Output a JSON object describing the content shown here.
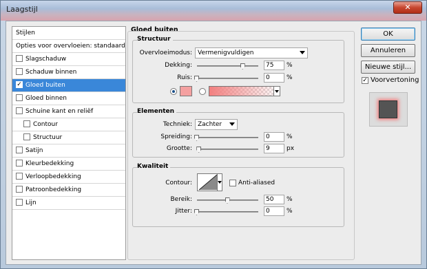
{
  "window": {
    "title": "Laagstijl",
    "close_glyph": "✕"
  },
  "style_list": {
    "header": "Stijlen",
    "blending": "Opties voor overvloeien: standaard",
    "items": [
      {
        "label": "Slagschaduw",
        "checked": false,
        "selected": false,
        "indent": false
      },
      {
        "label": "Schaduw binnen",
        "checked": false,
        "selected": false,
        "indent": false
      },
      {
        "label": "Gloed buiten",
        "checked": true,
        "selected": true,
        "indent": false
      },
      {
        "label": "Gloed binnen",
        "checked": false,
        "selected": false,
        "indent": false
      },
      {
        "label": "Schuine kant en reliëf",
        "checked": false,
        "selected": false,
        "indent": false
      },
      {
        "label": "Contour",
        "checked": false,
        "selected": false,
        "indent": true
      },
      {
        "label": "Structuur",
        "checked": false,
        "selected": false,
        "indent": true
      },
      {
        "label": "Satijn",
        "checked": false,
        "selected": false,
        "indent": false
      },
      {
        "label": "Kleurbedekking",
        "checked": false,
        "selected": false,
        "indent": false
      },
      {
        "label": "Verloopbedekking",
        "checked": false,
        "selected": false,
        "indent": false
      },
      {
        "label": "Patroonbedekking",
        "checked": false,
        "selected": false,
        "indent": false
      },
      {
        "label": "Lijn",
        "checked": false,
        "selected": false,
        "indent": false
      }
    ]
  },
  "panel": {
    "title": "Gloed buiten",
    "structure": {
      "title": "Structuur",
      "blend_mode_label": "Overvloeimodus:",
      "blend_mode_value": "Vermenigvuldigen",
      "opacity_label": "Dekking:",
      "opacity_value": "75",
      "opacity_pct": 75,
      "noise_label": "Ruis:",
      "noise_value": "0",
      "noise_pct": 0,
      "unit_pct": "%",
      "color_swatch": "#f4a0a0",
      "solid_selected": true
    },
    "elements": {
      "title": "Elementen",
      "technique_label": "Techniek:",
      "technique_value": "Zachter",
      "spread_label": "Spreiding:",
      "spread_value": "0",
      "spread_pct": 0,
      "size_label": "Grootte:",
      "size_value": "9",
      "size_fraction": 0.036,
      "unit_px": "px",
      "unit_pct": "%"
    },
    "quality": {
      "title": "Kwaliteit",
      "contour_label": "Contour:",
      "antialias_label": "Anti-aliased",
      "antialias_checked": false,
      "range_label": "Bereik:",
      "range_value": "50",
      "range_pct": 50,
      "jitter_label": "Jitter:",
      "jitter_value": "0",
      "jitter_pct": 0,
      "unit_pct": "%"
    }
  },
  "buttons": {
    "ok": "OK",
    "cancel": "Annuleren",
    "new_style": "Nieuwe stijl...",
    "preview_label": "Voorvertoning",
    "preview_checked": true
  },
  "colors": {
    "selection": "#3a87d9",
    "glow": "#f08080",
    "preview_box": "#545454"
  }
}
